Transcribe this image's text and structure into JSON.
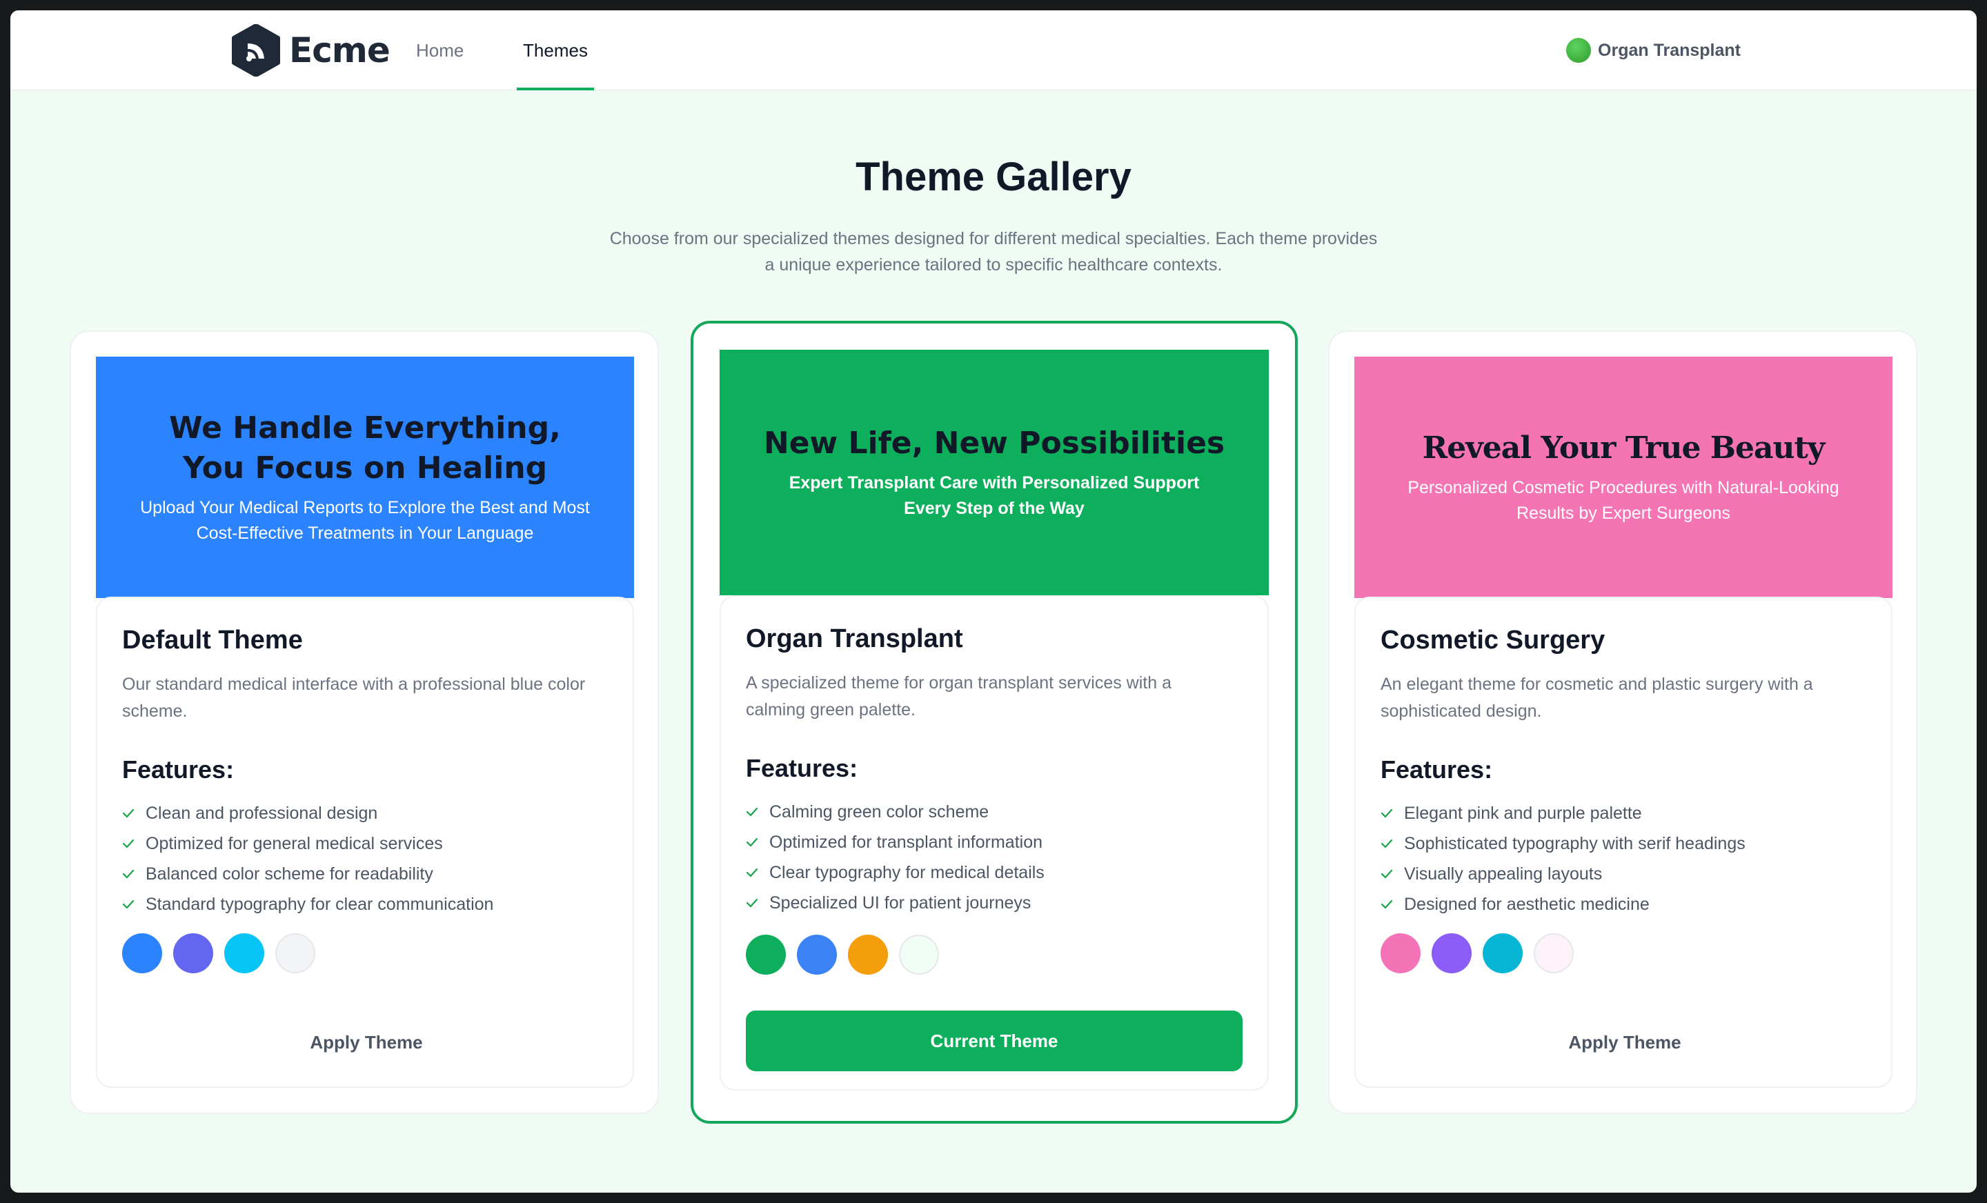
{
  "app": {
    "brand": "Ecme",
    "nav": {
      "home": "Home",
      "themes": "Themes"
    },
    "active_theme_label": "Organ Transplant",
    "accent_color": "#0daf5d"
  },
  "hero": {
    "title": "Theme Gallery",
    "subtitle_line1": "Choose from our specialized themes designed for different medical specialties. Each theme provides",
    "subtitle_line2": "a unique experience tailored to specific healthcare contexts."
  },
  "features_heading": "Features:",
  "themes": [
    {
      "preview_heading": "We Handle Everything, You Focus on Healing",
      "preview_sub": "Upload Your Medical Reports to Explore the Best and Most Cost-Effective Treatments in Your Language",
      "preview_color": "#2b84fe",
      "name": "Default Theme",
      "description": "Our standard medical interface with a professional blue color scheme.",
      "features": [
        "Clean and professional design",
        "Optimized for general medical services",
        "Balanced color scheme for readability",
        "Standard typography for clear communication"
      ],
      "palette": [
        "#2b84fe",
        "#6366f1",
        "#06c4f5",
        "#f3f4f6"
      ],
      "button": "Apply Theme"
    },
    {
      "preview_heading": "New Life, New Possibilities",
      "preview_sub": "Expert Transplant Care with Personalized Support Every Step of the Way",
      "preview_color": "#0daf5d",
      "name": "Organ Transplant",
      "description": "A specialized theme for organ transplant services with a calming green palette.",
      "features": [
        "Calming green color scheme",
        "Optimized for transplant information",
        "Clear typography for medical details",
        "Specialized UI for patient journeys"
      ],
      "palette": [
        "#0daf5d",
        "#3b82f6",
        "#f59e0b",
        "#f0fdf4"
      ],
      "button": "Current Theme"
    },
    {
      "preview_heading": "Reveal Your True Beauty",
      "preview_sub": "Personalized Cosmetic Procedures with Natural-Looking Results by Expert Surgeons",
      "preview_color": "#f474b4",
      "name": "Cosmetic Surgery",
      "description": "An elegant theme for cosmetic and plastic surgery with a sophisticated design.",
      "features": [
        "Elegant pink and purple palette",
        "Sophisticated typography with serif headings",
        "Visually appealing layouts",
        "Designed for aesthetic medicine"
      ],
      "palette": [
        "#f472b6",
        "#8b5cf6",
        "#06b6d4",
        "#fdf2f8"
      ],
      "button": "Apply Theme"
    }
  ]
}
